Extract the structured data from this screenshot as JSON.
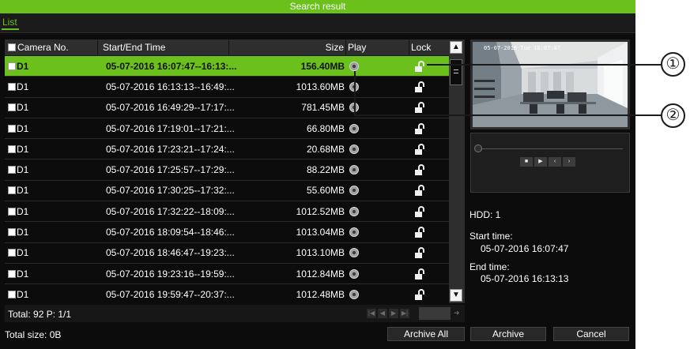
{
  "window": {
    "title": "Search result"
  },
  "tabs": [
    {
      "label": "List"
    }
  ],
  "table": {
    "columns": {
      "camera": "Camera No.",
      "time": "Start/End Time",
      "size": "Size",
      "play": "Play",
      "lock": "Lock"
    },
    "rows": [
      {
        "camera": "D1",
        "time": "05-07-2016 16:07:47--16:13:...",
        "size": "156.40MB",
        "selected": true
      },
      {
        "camera": "D1",
        "time": "05-07-2016 16:13:13--16:49:...",
        "size": "1013.60MB"
      },
      {
        "camera": "D1",
        "time": "05-07-2016 16:49:29--17:17:...",
        "size": "781.45MB"
      },
      {
        "camera": "D1",
        "time": "05-07-2016 17:19:01--17:21:...",
        "size": "66.80MB"
      },
      {
        "camera": "D1",
        "time": "05-07-2016 17:23:21--17:24:...",
        "size": "20.68MB"
      },
      {
        "camera": "D1",
        "time": "05-07-2016 17:25:57--17:29:...",
        "size": "88.22MB"
      },
      {
        "camera": "D1",
        "time": "05-07-2016 17:30:25--17:32:...",
        "size": "55.60MB"
      },
      {
        "camera": "D1",
        "time": "05-07-2016 17:32:22--18:09:...",
        "size": "1012.52MB"
      },
      {
        "camera": "D1",
        "time": "05-07-2016 18:09:54--18:46:...",
        "size": "1013.04MB"
      },
      {
        "camera": "D1",
        "time": "05-07-2016 18:46:47--19:23:...",
        "size": "1013.10MB"
      },
      {
        "camera": "D1",
        "time": "05-07-2016 19:23:16--19:59:...",
        "size": "1012.84MB"
      },
      {
        "camera": "D1",
        "time": "05-07-2016 19:59:47--20:37:...",
        "size": "1012.48MB"
      }
    ]
  },
  "footer": {
    "total": "Total: 92  P: 1/1",
    "total_size": "Total size: 0B"
  },
  "preview": {
    "osd": "05-07-2016 Tue 16:07:47"
  },
  "info": {
    "hdd": "HDD: 1",
    "start_label": "Start time:",
    "start_value": "05-07-2016 16:07:47",
    "end_label": "End time:",
    "end_value": "05-07-2016 16:13:13"
  },
  "buttons": {
    "archive_all": "Archive All",
    "archive": "Archive",
    "cancel": "Cancel"
  },
  "callouts": [
    "①",
    "②"
  ],
  "icons": {
    "check": "checkbox-icon",
    "play": "play-icon",
    "lock": "unlocked-padlock-icon",
    "scroll_up": "chevron-up-icon",
    "scroll_down": "chevron-down-icon"
  },
  "colors": {
    "accent": "#6cc01c",
    "window_bg": "#0c0c0c",
    "panel_bg": "#2e2e2e"
  }
}
